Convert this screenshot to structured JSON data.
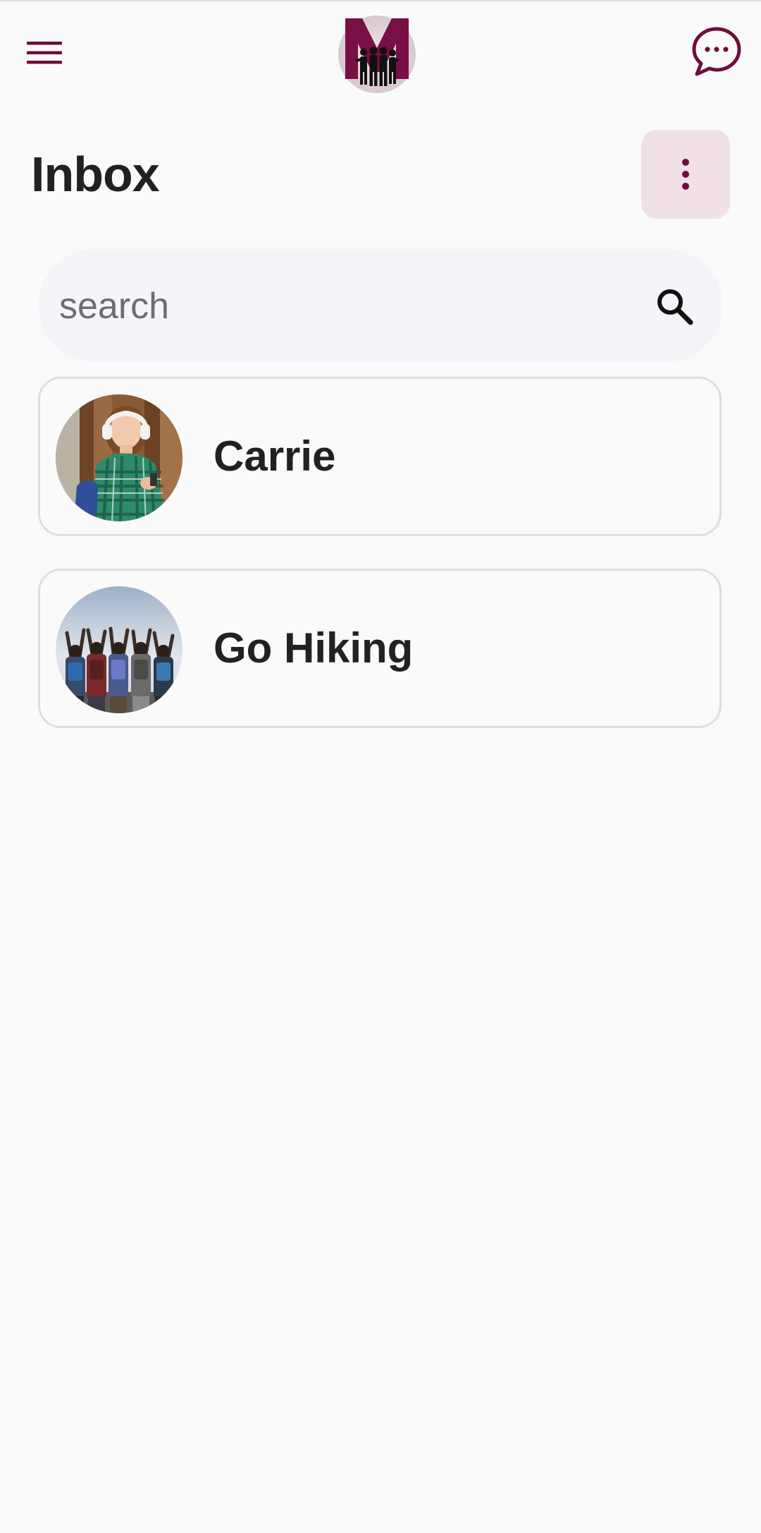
{
  "header": {
    "menu_icon": "hamburger-menu-icon",
    "logo_icon": "app-logo-m-people",
    "chat_icon": "chat-bubble-dots-icon"
  },
  "page": {
    "title": "Inbox",
    "more_icon": "vertical-dots-icon"
  },
  "search": {
    "placeholder": "search",
    "value": "",
    "icon": "search-icon"
  },
  "conversations": [
    {
      "name": "Carrie",
      "avatar": "photo-girl-headphones-plaid-shirt"
    },
    {
      "name": "Go Hiking",
      "avatar": "photo-group-hikers-raising-arms"
    }
  ],
  "colors": {
    "accent": "#6d0f3c",
    "accent_light": "#f1e1e7",
    "search_bg": "#f4f5f9",
    "text": "#212121",
    "background": "#fafafa",
    "card_border": "#dedede"
  }
}
